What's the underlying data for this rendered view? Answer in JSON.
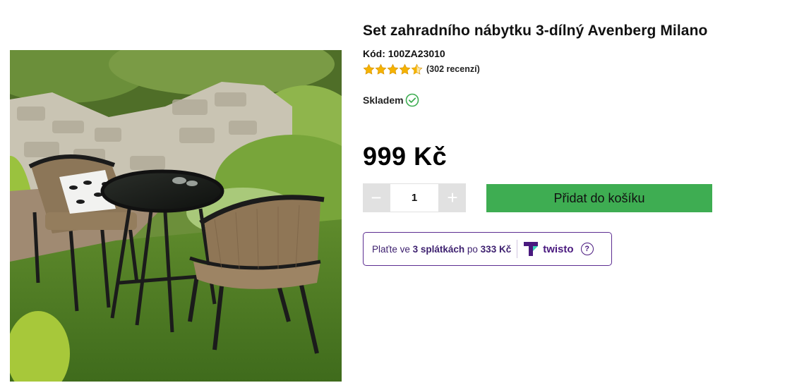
{
  "product": {
    "title": "Set zahradního nábytku 3-dílný Avenberg Milano",
    "code": "Kód: 100ZA23010",
    "rating": 4.5,
    "rating_count": "(302 recenzí)",
    "stock": "Skladem",
    "price": "999 Kč",
    "image_icon": "garden-furniture-photo"
  },
  "quantity": {
    "minus": "−",
    "plus": "+",
    "value": "1"
  },
  "cart": {
    "label": "Přidat do košíku"
  },
  "twisto": {
    "prefix": "Plaťte ve ",
    "installments": "3 splátkách",
    "middle": " po ",
    "amount": "333 Kč",
    "brand": "twisto",
    "help": "?"
  },
  "colors": {
    "accent_green": "#3ead52",
    "twisto_purple": "#4a1a7f",
    "star": "#f5b301"
  }
}
